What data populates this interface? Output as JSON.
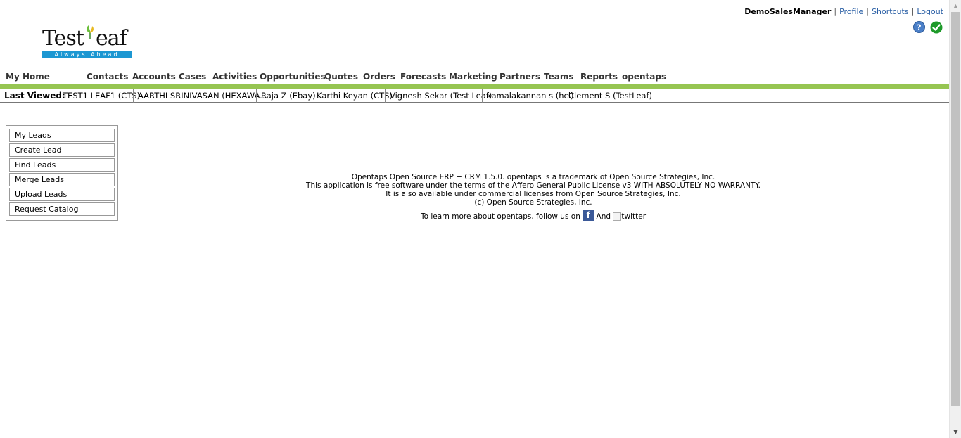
{
  "header": {
    "username": "DemoSalesManager",
    "links": [
      "Profile",
      "Shortcuts",
      "Logout"
    ]
  },
  "logo": {
    "name": "TestLeaf",
    "tagline": "Always Ahead"
  },
  "nav": {
    "items": [
      "My Home",
      "Contacts",
      "Accounts",
      "Cases",
      "Activities",
      "Opportunities",
      "Quotes",
      "Orders",
      "Forecasts",
      "Marketing",
      "Partners",
      "Teams",
      "Reports",
      "opentaps"
    ]
  },
  "last_viewed": {
    "label": "Last Viewed:",
    "items": [
      "TEST1 LEAF1 (CTS)",
      "AARTHI SRINIVASAN (HEXAWA...",
      "Raja Z (Ebay)",
      "Karthi Keyan (CTS)",
      "Vignesh Sekar (Test Leaf)",
      "kamalakannan s (hcl)",
      "Clement S (TestLeaf)"
    ]
  },
  "side_menu": {
    "items": [
      "My Leads",
      "Create Lead",
      "Find Leads",
      "Merge Leads",
      "Upload Leads",
      "Request Catalog"
    ]
  },
  "footer": {
    "lines": [
      "Opentaps Open Source ERP + CRM 1.5.0. opentaps is a trademark of Open Source Strategies, Inc.",
      "This application is free software under the terms of the Affero General Public License v3 WITH ABSOLUTELY NO WARRANTY.",
      "It is also available under commercial licenses from Open Source Strategies, Inc.",
      "(c) Open Source Strategies, Inc."
    ],
    "follow_text": "To learn more about opentaps, follow us on",
    "and_text": "And",
    "twitter_alt": "twitter"
  },
  "colors": {
    "nav_bar": "#96c552",
    "link": "#2a5fa5",
    "logo_bar": "#1c97d2"
  }
}
